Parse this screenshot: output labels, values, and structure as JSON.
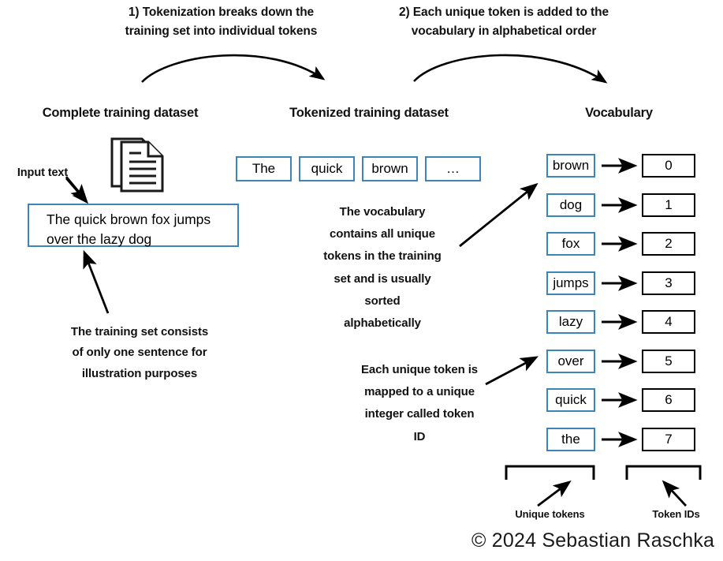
{
  "captions": [
    {
      "id": "step1",
      "line1": "1) Tokenization breaks down the",
      "line2": "training set into individual tokens"
    },
    {
      "id": "step2",
      "line1": "2) Each unique token is added to the",
      "line2": "vocabulary in alphabetical order"
    }
  ],
  "columns": {
    "left_header": "Complete training dataset",
    "middle_header": "Tokenized training dataset",
    "right_header": "Vocabulary"
  },
  "input": {
    "label": "Input text",
    "line1": "The quick brown fox jumps",
    "line2": "over the lazy dog"
  },
  "tokens": [
    "The",
    "quick",
    "brown",
    "…"
  ],
  "annotations": {
    "training_set_note": [
      "The training set consists",
      "of only one sentence for",
      "illustration purposes"
    ],
    "vocabulary_note": [
      "The vocabulary",
      "contains all unique",
      "tokens in the training",
      "set and is usually",
      "sorted",
      "alphabetically"
    ],
    "token_id_note": [
      "Each unique token is",
      "mapped to a unique",
      "integer called token",
      "ID"
    ]
  },
  "vocabulary": [
    {
      "token": "brown",
      "id": "0"
    },
    {
      "token": "dog",
      "id": "1"
    },
    {
      "token": "fox",
      "id": "2"
    },
    {
      "token": "jumps",
      "id": "3"
    },
    {
      "token": "lazy",
      "id": "4"
    },
    {
      "token": "over",
      "id": "5"
    },
    {
      "token": "quick",
      "id": "6"
    },
    {
      "token": "the",
      "id": "7"
    }
  ],
  "bottom_labels": {
    "unique_tokens": "Unique tokens",
    "token_ids": "Token IDs"
  },
  "copyright": "© 2024 Sebastian Raschka",
  "colors": {
    "box_blue": "#3d85b8",
    "box_black": "#000000",
    "background": "#ffffff",
    "text": "#111111"
  }
}
